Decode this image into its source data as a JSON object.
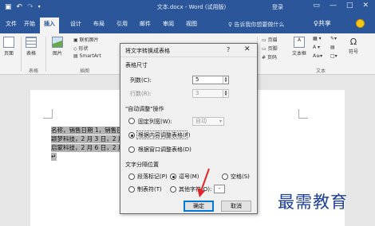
{
  "titlebar": {
    "doc_title": "文本.docx - Word (试用版)",
    "login": "登录",
    "qat_icons": [
      "save-icon",
      "undo-icon",
      "redo-icon",
      "customize-icon"
    ],
    "window_controls": [
      "ribbon-options-icon",
      "minimize-icon",
      "restore-icon",
      "close-icon"
    ]
  },
  "tabs": {
    "items": [
      "文件",
      "开始",
      "插入",
      "设计",
      "布局",
      "引用",
      "邮件",
      "审阅",
      "视图"
    ],
    "active": "插入",
    "tell_me": "♀ 告诉我你想要做什么",
    "share": "♀共享"
  },
  "ribbon": {
    "page": "页面",
    "table": "表格",
    "picture": "图片",
    "online_picture": "联机图片",
    "shapes": "形状",
    "smartart": "SmartArt",
    "group_tables": "表格",
    "group_illustrations": "插图",
    "header": "页眉",
    "footer": "页脚",
    "page_number": "页码",
    "textbox": "文本框",
    "symbol": "符号",
    "group_text": "文本"
  },
  "document": {
    "lines": [
      "名称，销售日期 1，销售日",
      "颖梦科技，2 月 3 日，2 月 8",
      "启蒙科技，2 月 6 日，2 月 8"
    ],
    "bullet": "↵"
  },
  "dialog": {
    "title": "将文字转换成表格",
    "help": "?",
    "close": "✕",
    "table_size_label": "表格尺寸",
    "columns_label": "列数(C):",
    "columns_value": "5",
    "rows_label": "行数(R):",
    "rows_value": "3",
    "autofit_label": "\"自动调整\"操作",
    "fixed_width_label": "固定列宽(W):",
    "fixed_width_value": "自动",
    "autofit_content_label": "根据内容调整表格(F)",
    "autofit_window_label": "根据窗口调整表格(D)",
    "separator_label": "文字分隔位置",
    "sep_paragraph": "段落标记(P)",
    "sep_comma": "逗号(M)",
    "sep_space": "空格(S)",
    "sep_tab": "制表符(T)",
    "sep_other": "其他字符(O):",
    "sep_other_value": "-",
    "ok": "确定",
    "cancel": "取消"
  },
  "watermark": "最需教育",
  "colors": {
    "accent": "#2b579a",
    "arrow": "#e0262b",
    "watermark": "#1d3f9c"
  }
}
